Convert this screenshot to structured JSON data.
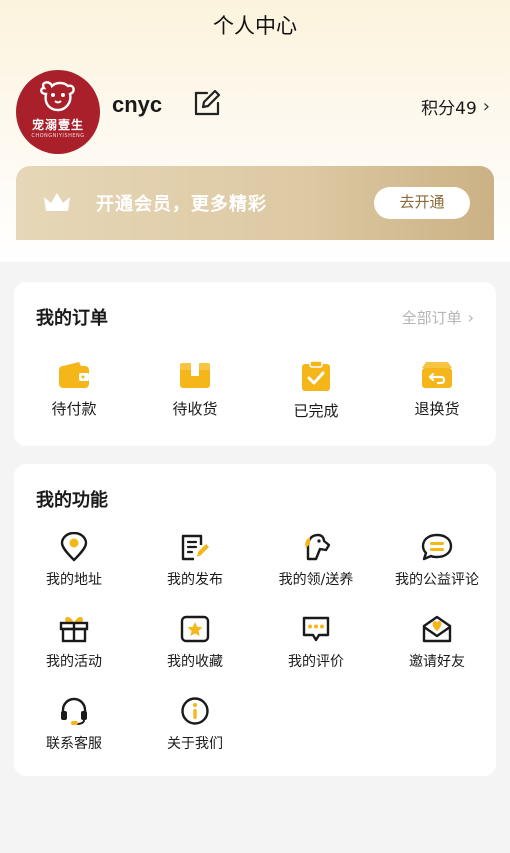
{
  "header": {
    "title": "个人中心"
  },
  "profile": {
    "avatar_brand": "宠溺壹生",
    "avatar_brand_sub": "CHONGNIYISHENG",
    "username": "cnyc",
    "points_label": "积分49"
  },
  "vip": {
    "text": "开通会员，更多精彩",
    "button": "去开通"
  },
  "orders": {
    "title": "我的订单",
    "all_label": "全部订单",
    "items": [
      {
        "label": "待付款",
        "icon": "wallet-icon"
      },
      {
        "label": "待收货",
        "icon": "package-icon"
      },
      {
        "label": "已完成",
        "icon": "clipboard-check-icon"
      },
      {
        "label": "退换货",
        "icon": "return-box-icon"
      }
    ]
  },
  "features": {
    "title": "我的功能",
    "items": [
      {
        "label": "我的地址",
        "icon": "location-icon"
      },
      {
        "label": "我的发布",
        "icon": "edit-document-icon"
      },
      {
        "label": "我的领/送养",
        "icon": "dog-icon"
      },
      {
        "label": "我的公益评论",
        "icon": "chat-bubble-icon"
      },
      {
        "label": "我的活动",
        "icon": "gift-icon"
      },
      {
        "label": "我的收藏",
        "icon": "star-icon"
      },
      {
        "label": "我的评价",
        "icon": "comment-icon"
      },
      {
        "label": "邀请好友",
        "icon": "envelope-icon"
      },
      {
        "label": "联系客服",
        "icon": "headset-icon"
      },
      {
        "label": "关于我们",
        "icon": "info-icon"
      }
    ]
  },
  "colors": {
    "accent": "#f5b61a",
    "dark": "#1a1a1a",
    "vip_gold": "#d8c397",
    "brand_red": "#a9202b"
  }
}
